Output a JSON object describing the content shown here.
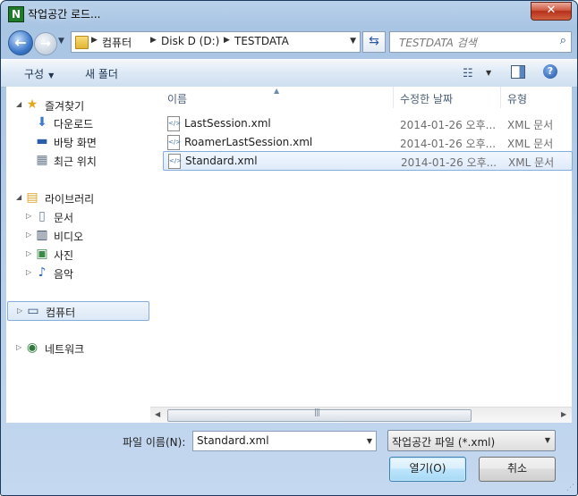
{
  "window": {
    "title": "작업공간 로드...",
    "app_icon": "N",
    "close_glyph": "✕"
  },
  "navbar": {
    "breadcrumbs": [
      "컴퓨터",
      "Disk D (D:)",
      "TESTDATA"
    ],
    "search_placeholder": "TESTDATA 검색"
  },
  "toolbar": {
    "organize": "구성",
    "new_folder": "새 폴더"
  },
  "nav_pane": {
    "favorites": {
      "label": "즐겨찾기",
      "items": [
        "다운로드",
        "바탕 화면",
        "최근 위치"
      ]
    },
    "libraries": {
      "label": "라이브러리",
      "items": [
        "문서",
        "비디오",
        "사진",
        "음악"
      ]
    },
    "computer": "컴퓨터",
    "network": "네트워크"
  },
  "file_list": {
    "columns": [
      "이름",
      "수정한 날짜",
      "유형"
    ],
    "rows": [
      {
        "name": "LastSession.xml",
        "date": "2014-01-26 오후...",
        "type": "XML 문서"
      },
      {
        "name": "RoamerLastSession.xml",
        "date": "2014-01-26 오후...",
        "type": "XML 문서"
      },
      {
        "name": "Standard.xml",
        "date": "2014-01-26 오후...",
        "type": "XML 문서"
      }
    ],
    "selected_index": 2
  },
  "bottom": {
    "filename_label": "파일 이름(N):",
    "filename_value": "Standard.xml",
    "filetype_value": "작업공간 파일 (*.xml)",
    "open_button": "열기(O)",
    "cancel_button": "취소"
  },
  "colors": {
    "title_bg": "#b9d1ea",
    "selection_border": "#84acdd",
    "close_red": "#cf5a40"
  }
}
